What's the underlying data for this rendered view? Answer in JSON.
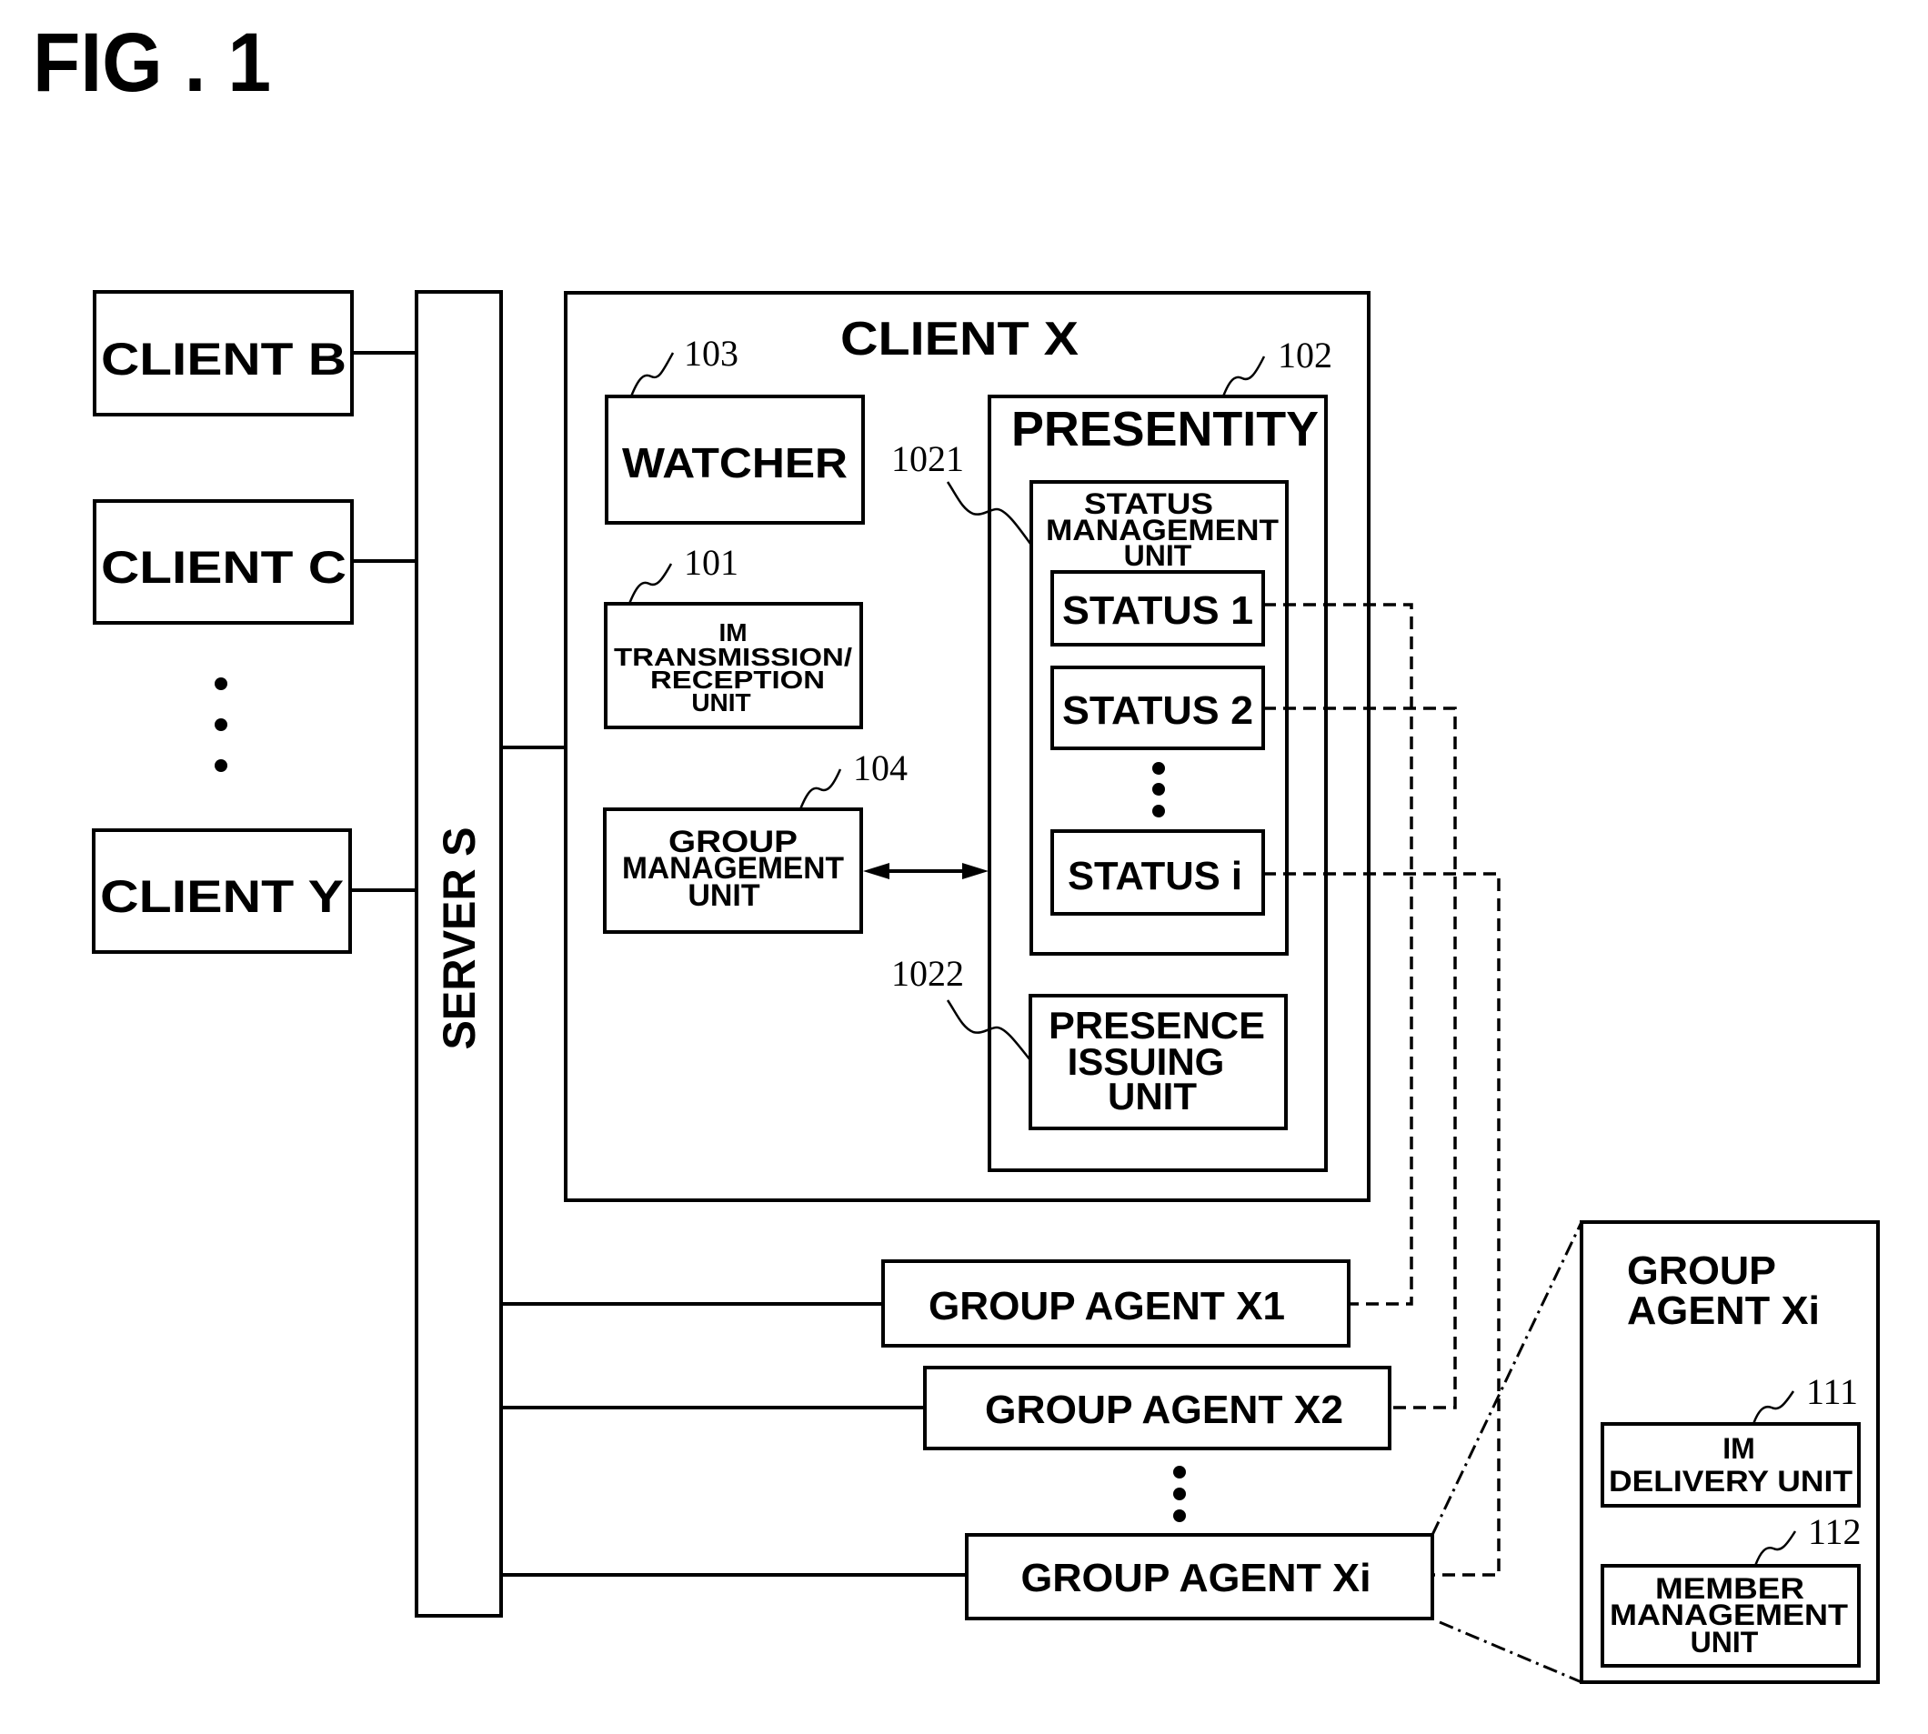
{
  "figure": {
    "title": "FIG . 1"
  },
  "clients": [
    {
      "label": "CLIENT B"
    },
    {
      "label": "CLIENT C"
    },
    {
      "label": "CLIENT Y"
    }
  ],
  "server": {
    "label": "SERVER S"
  },
  "client_x": {
    "label": "CLIENT X",
    "watcher": {
      "label": "WATCHER",
      "ref": "103"
    },
    "im_unit": {
      "lines": [
        "IM",
        "TRANSMISSION/",
        "RECEPTION",
        "UNIT"
      ],
      "ref": "101"
    },
    "group_mgmt": {
      "lines": [
        "GROUP",
        "MANAGEMENT",
        "UNIT"
      ],
      "ref": "104"
    },
    "presentity": {
      "label": "PRESENTITY",
      "ref": "102",
      "status_mgmt": {
        "lines": [
          "STATUS",
          "MANAGEMENT",
          "UNIT"
        ],
        "ref": "1021",
        "statuses": [
          {
            "label": "STATUS 1"
          },
          {
            "label": "STATUS 2"
          },
          {
            "label": "STATUS i"
          }
        ]
      },
      "presence_issuing": {
        "lines": [
          "PRESENCE",
          "ISSUING",
          "UNIT"
        ],
        "ref": "1022"
      }
    }
  },
  "group_agents": [
    {
      "label": "GROUP AGENT X1"
    },
    {
      "label": "GROUP AGENT X2"
    },
    {
      "label": "GROUP AGENT Xi"
    }
  ],
  "detail": {
    "title_lines": [
      "GROUP",
      "AGENT Xi"
    ],
    "im_delivery": {
      "lines": [
        "IM",
        "DELIVERY UNIT"
      ],
      "ref": "111"
    },
    "member_mgmt": {
      "lines": [
        "MEMBER",
        "MANAGEMENT",
        "UNIT"
      ],
      "ref": "112"
    }
  }
}
